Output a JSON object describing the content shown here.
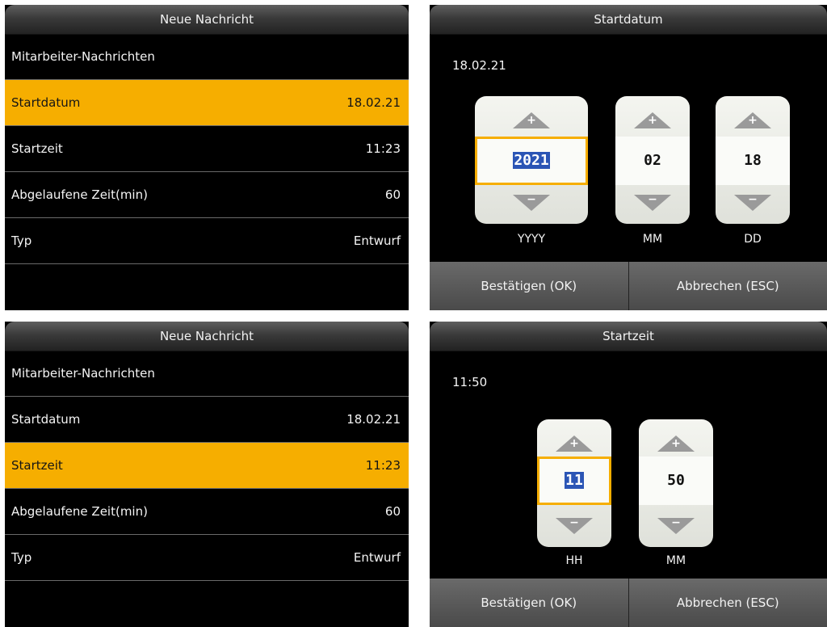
{
  "new_message_panel": {
    "title": "Neue Nachricht",
    "header_row": "Mitarbeiter-Nachrichten",
    "rows": [
      {
        "label": "Startdatum",
        "value": "18.02.21"
      },
      {
        "label": "Startzeit",
        "value": "11:23"
      },
      {
        "label": "Abgelaufene Zeit(min)",
        "value": "60"
      },
      {
        "label": "Typ",
        "value": "Entwurf"
      }
    ]
  },
  "date_dialog": {
    "title": "Startdatum",
    "preview": "18.02.21",
    "fields": [
      {
        "value": "2021",
        "unit": "YYYY"
      },
      {
        "value": "02",
        "unit": "MM"
      },
      {
        "value": "18",
        "unit": "DD"
      }
    ],
    "ok_label": "Bestätigen (OK)",
    "cancel_label": "Abbrechen (ESC)"
  },
  "time_dialog": {
    "title": "Startzeit",
    "preview": "11:50",
    "fields": [
      {
        "value": "11",
        "unit": "HH"
      },
      {
        "value": "50",
        "unit": "MM"
      }
    ],
    "ok_label": "Bestätigen (OK)",
    "cancel_label": "Abbrechen (ESC)"
  },
  "spinner": {
    "up_sign": "+",
    "down_sign": "−"
  },
  "colors": {
    "selection": "#f6ae00",
    "background": "#000000",
    "text": "#f4f4f4",
    "text_highlight": "#2b55b5"
  }
}
